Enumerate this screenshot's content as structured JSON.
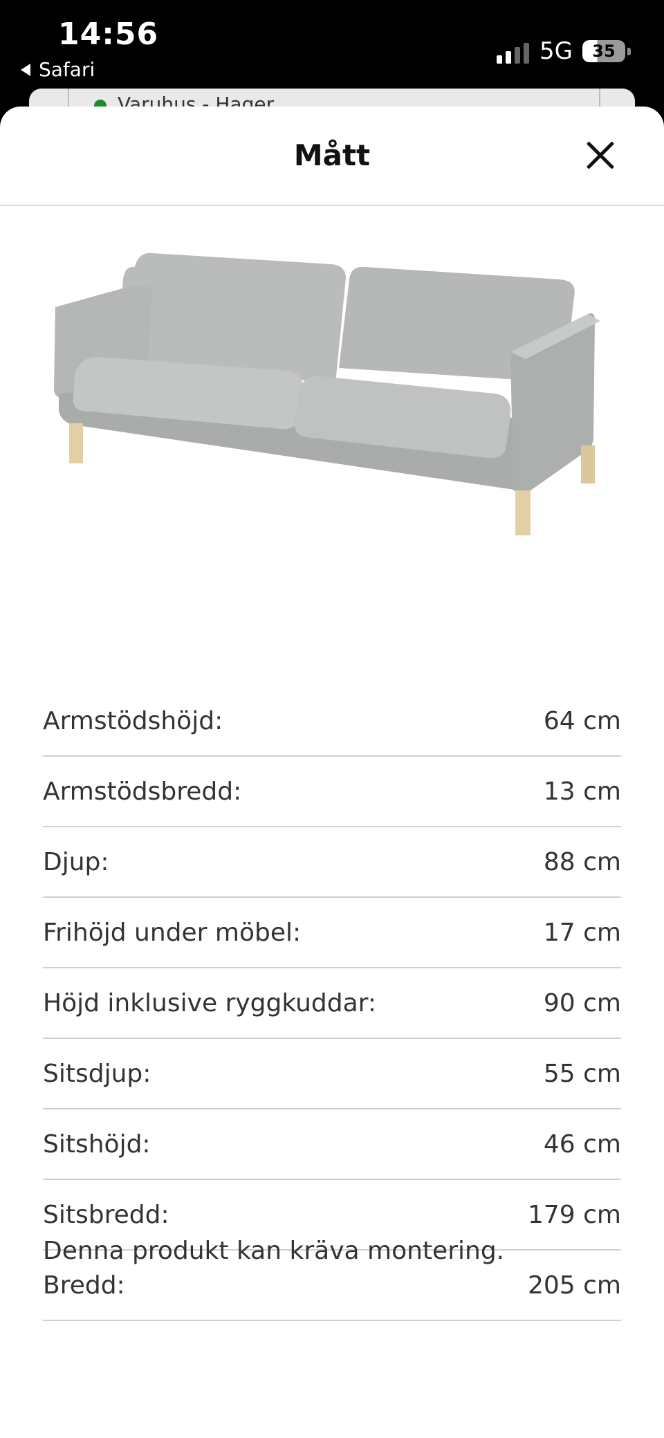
{
  "status_bar": {
    "time": "14:56",
    "back_app": "Safari",
    "network": "5G",
    "battery": "35",
    "battery_level_percent": 35
  },
  "background_page": {
    "store_status_text": "Varuhus - Hager"
  },
  "sheet": {
    "title": "Mått",
    "close_icon": "close-icon"
  },
  "product_image": {
    "icon": "sofa-image",
    "colors": {
      "fabric": "#b9bcbb",
      "legs": "#e3cfa5"
    }
  },
  "dimensions": [
    {
      "label": "Armstödshöjd:",
      "value": "64 cm"
    },
    {
      "label": "Armstödsbredd:",
      "value": "13 cm"
    },
    {
      "label": "Djup:",
      "value": "88 cm"
    },
    {
      "label": "Frihöjd under möbel:",
      "value": "17 cm"
    },
    {
      "label": "Höjd inklusive ryggkuddar:",
      "value": "90 cm"
    },
    {
      "label": "Sitsdjup:",
      "value": "55 cm"
    },
    {
      "label": "Sitshöjd:",
      "value": "46 cm"
    },
    {
      "label": "Sitsbredd:",
      "value": "179 cm"
    },
    {
      "label": "Bredd:",
      "value": "205 cm"
    }
  ],
  "assembly_note": "Denna produkt kan kräva montering."
}
